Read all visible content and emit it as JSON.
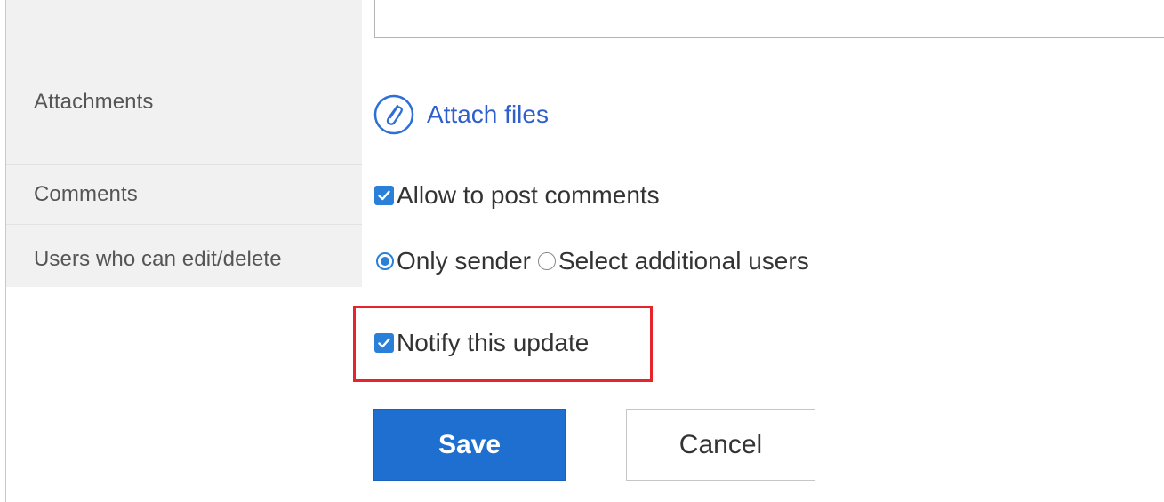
{
  "form": {
    "rows": {
      "attachments": {
        "label": "Attachments",
        "action_label": "Attach files",
        "icon": "paperclip-icon"
      },
      "comments": {
        "label": "Comments",
        "option_label": "Allow to post comments",
        "checked": true
      },
      "editors": {
        "label": "Users who can edit/delete",
        "options": [
          {
            "label": "Only sender",
            "selected": true
          },
          {
            "label": "Select additional users",
            "selected": false
          }
        ]
      },
      "notify": {
        "option_label": "Notify this update",
        "checked": true
      }
    },
    "buttons": {
      "save_label": "Save",
      "cancel_label": "Cancel"
    }
  },
  "colors": {
    "accent": "#1e6fd0",
    "link": "#2e5fcc",
    "highlight": "#e5242b",
    "label_bg": "#f1f1f1"
  }
}
